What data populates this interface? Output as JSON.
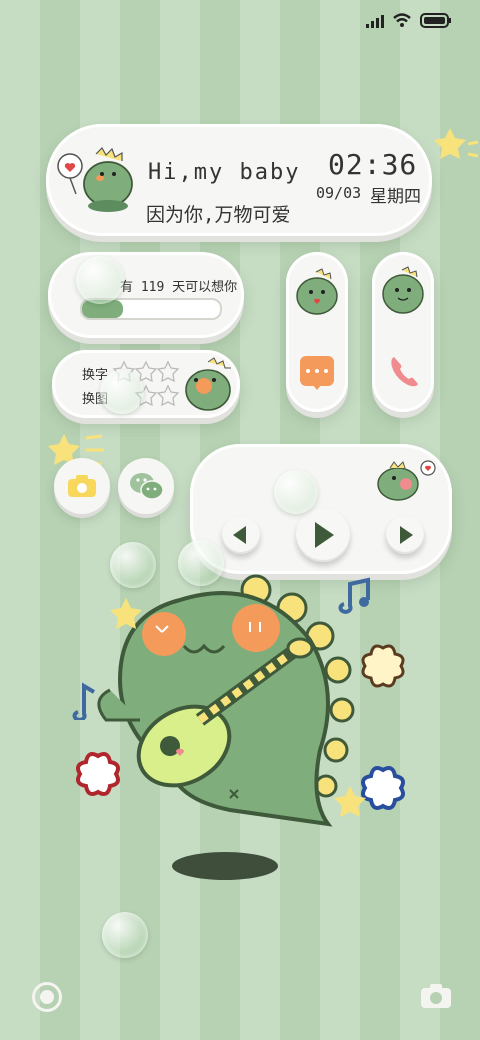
{
  "status_bar": {
    "signal_icon": "signal-icon",
    "wifi_icon": "wifi-icon",
    "battery_icon": "battery-icon"
  },
  "clock_widget": {
    "greeting": "Hi,my baby",
    "tagline": "因为你,万物可爱",
    "time": "02:36",
    "date": "09/03",
    "weekday": "星期四"
  },
  "counter_widget": {
    "text": "有 119 天可以想你",
    "progress_fraction": 0.3
  },
  "theme_widget": {
    "line1": "换字",
    "line2": "换图"
  },
  "apps": {
    "message_icon": "message-icon",
    "phone_icon": "phone-icon",
    "camera_icon": "camera-icon",
    "wechat_icon": "wechat-icon"
  },
  "music_widget": {
    "prev_icon": "prev-icon",
    "play_icon": "play-icon",
    "next_icon": "next-icon"
  },
  "colors": {
    "accent_green": "#5d8d5e",
    "dino_green": "#7fae7c",
    "dark_green": "#3f5a3a",
    "orange": "#f49a5b",
    "pink": "#f08b8f",
    "yellow": "#f7e27c"
  }
}
